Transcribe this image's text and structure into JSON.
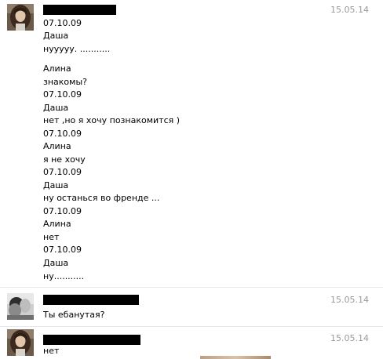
{
  "messages": [
    {
      "date": "15.05.14",
      "avatar": "avatar-woman-long-hair",
      "lines": [
        "07.10.09",
        "Даша",
        "нууууу. ...........",
        "",
        "Алина",
        "знакомы?",
        "07.10.09",
        "Даша",
        "нет ,но я хочу познакомится )",
        "07.10.09",
        "Алина",
        "я не хочу",
        "07.10.09",
        "Даша",
        "ну останься во френде ...",
        "07.10.09",
        "Алина",
        "нет",
        "07.10.09",
        "Даша",
        "ну..........."
      ]
    },
    {
      "date": "15.05.14",
      "avatar": "avatar-bw-photo",
      "lines": [
        "Ты ебанутая?"
      ]
    },
    {
      "date": "15.05.14",
      "avatar": "avatar-woman-long-hair",
      "lines": [
        "нет"
      ]
    }
  ]
}
